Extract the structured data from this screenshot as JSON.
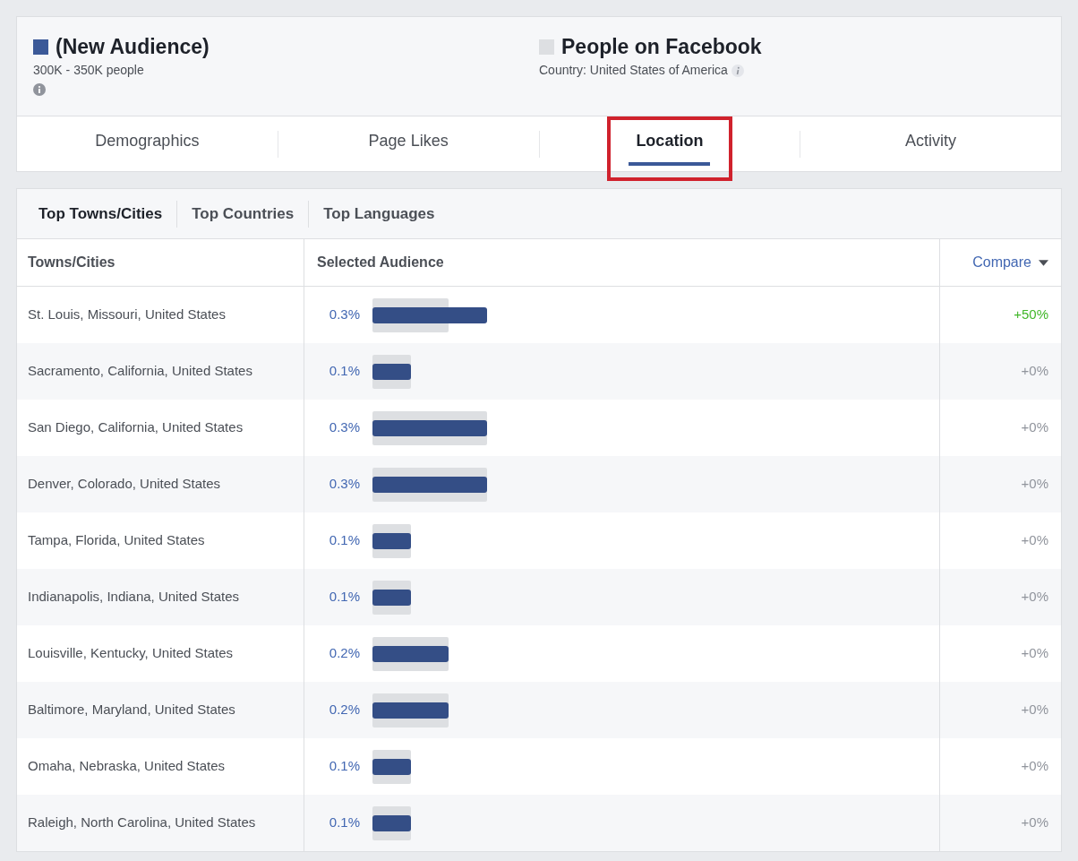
{
  "audiences": [
    {
      "name": "(New Audience)",
      "detail": "300K - 350K people",
      "color": "#3b5998",
      "kind": "primary"
    },
    {
      "name": "People on Facebook",
      "detail": "Country: United States of America",
      "color": "#dddfe2",
      "kind": "comparison"
    }
  ],
  "tabs": [
    {
      "label": "Demographics",
      "selected": false,
      "highlighted": false
    },
    {
      "label": "Page Likes",
      "selected": false,
      "highlighted": false
    },
    {
      "label": "Location",
      "selected": true,
      "highlighted": true
    },
    {
      "label": "Activity",
      "selected": false,
      "highlighted": false
    }
  ],
  "subtabs": [
    {
      "label": "Top Towns/Cities",
      "selected": true
    },
    {
      "label": "Top Countries",
      "selected": false
    },
    {
      "label": "Top Languages",
      "selected": false
    }
  ],
  "table": {
    "columns": [
      "Towns/Cities",
      "Selected Audience",
      "Compare"
    ],
    "rows": [
      {
        "place": "St. Louis, Missouri, United States",
        "share": "0.3%",
        "change": "+50%",
        "color": "#42b72a"
      },
      {
        "place": "Sacramento, California, United States",
        "share": "0.1%",
        "change": "+0%",
        "color": "#90949c"
      },
      {
        "place": "San Diego, California, United States",
        "share": "0.3%",
        "change": "+0%",
        "color": "#90949c"
      },
      {
        "place": "Denver, Colorado, United States",
        "share": "0.3%",
        "change": "+0%",
        "color": "#90949c"
      },
      {
        "place": "Tampa, Florida, United States",
        "share": "0.1%",
        "change": "+0%",
        "color": "#90949c"
      },
      {
        "place": "Indianapolis, Indiana, United States",
        "share": "0.1%",
        "change": "+0%",
        "color": "#90949c"
      },
      {
        "place": "Louisville, Kentucky, United States",
        "share": "0.2%",
        "change": "+0%",
        "color": "#90949c"
      },
      {
        "place": "Baltimore, Maryland, United States",
        "share": "0.2%",
        "change": "+0%",
        "color": "#90949c"
      },
      {
        "place": "Omaha, Nebraska, United States",
        "share": "0.1%",
        "change": "+0%",
        "color": "#90949c"
      },
      {
        "place": "Raleigh, North Carolina, United States",
        "share": "0.1%",
        "change": "+0%",
        "color": "#90949c"
      }
    ]
  }
}
